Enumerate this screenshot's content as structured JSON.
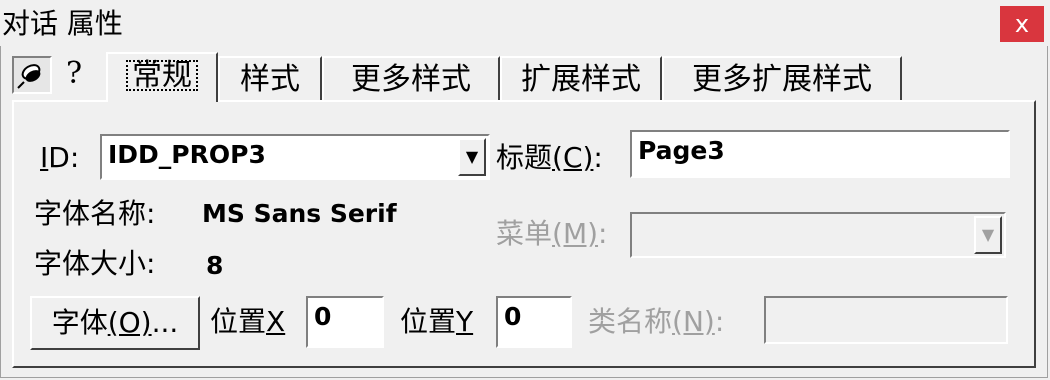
{
  "window": {
    "title": "对话 属性",
    "close_glyph": "x"
  },
  "toolbar": {
    "pin_icon": "pushpin-icon",
    "help_glyph": "?"
  },
  "tabs": [
    {
      "label": "常规",
      "active": true
    },
    {
      "label": "样式",
      "active": false
    },
    {
      "label": "更多样式",
      "active": false
    },
    {
      "label": "扩展样式",
      "active": false
    },
    {
      "label": "更多扩展样式",
      "active": false
    }
  ],
  "general": {
    "id_label_accel": "I",
    "id_label_rest": "D:",
    "id_value": "IDD_PROP3",
    "caption_label_text": "标题",
    "caption_label_accel": "(C)",
    "caption_label_colon": ":",
    "caption_value": "Page3",
    "font_name_label": "字体名称:",
    "font_name_value": "MS Sans Serif",
    "font_size_label": "字体大小:",
    "font_size_value": "8",
    "menu_label_text": "菜单",
    "menu_label_accel": "(M)",
    "menu_label_colon": ":",
    "menu_value": "",
    "font_button_text": "字体",
    "font_button_accel": "(O)",
    "font_button_ellipsis": "...",
    "pos_x_label_text": "位置",
    "pos_x_label_accel": "X",
    "pos_x_value": "0",
    "pos_y_label_text": "位置",
    "pos_y_label_accel": "Y",
    "pos_y_value": "0",
    "class_label_text": "类名称",
    "class_label_accel": "(N)",
    "class_label_colon": ":",
    "class_value": ""
  }
}
